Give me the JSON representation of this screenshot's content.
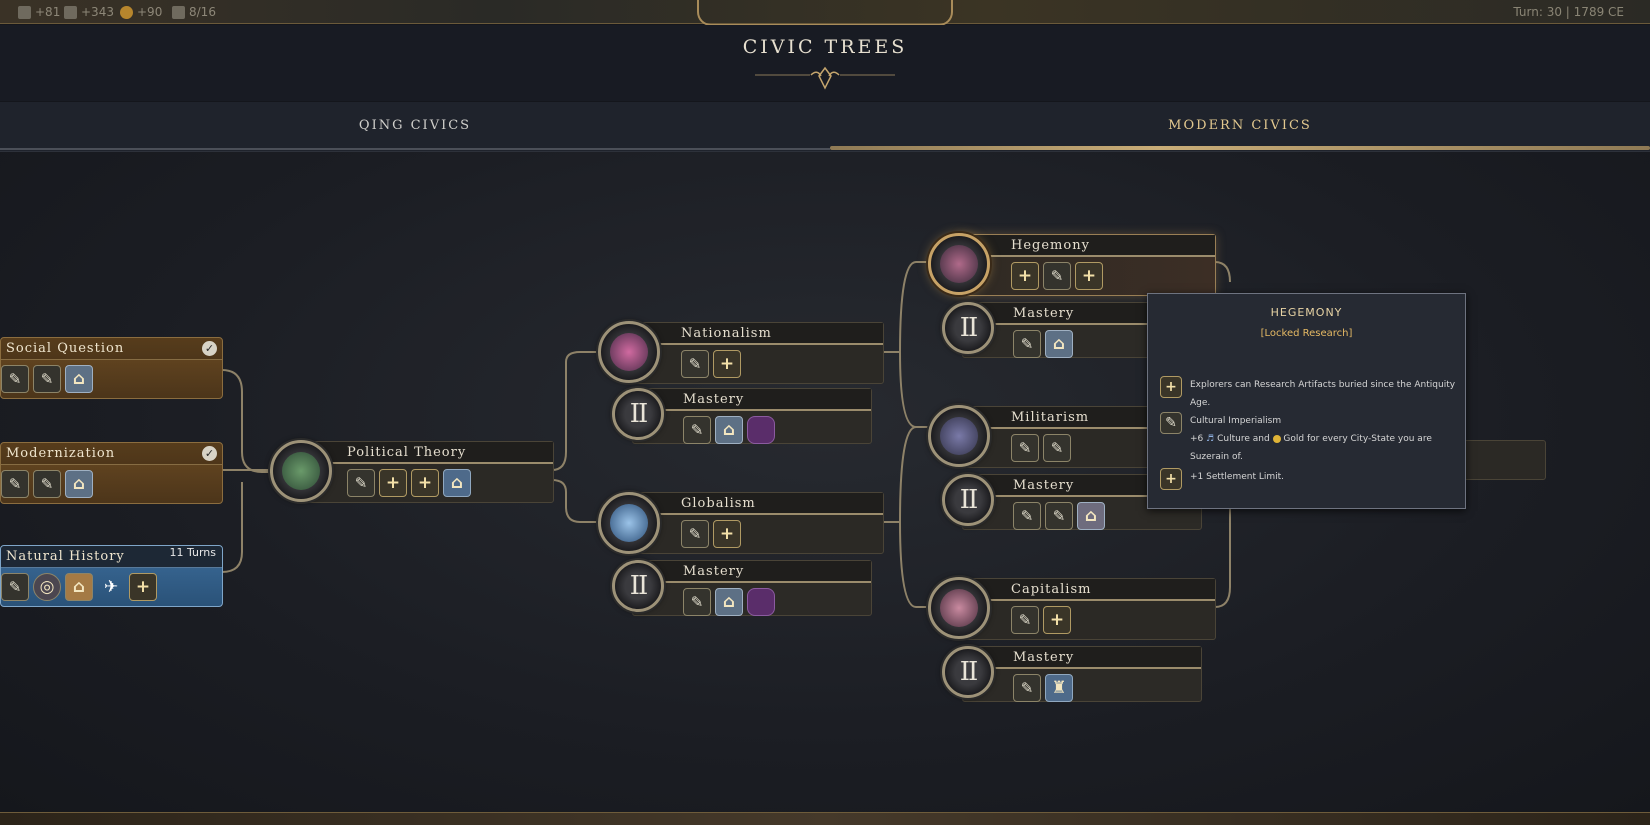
{
  "topbar": {
    "resources": [
      {
        "icon": "science-icon",
        "value": "+81"
      },
      {
        "icon": "culture-icon",
        "value": "+343"
      },
      {
        "icon": "gold-icon",
        "value": "+90"
      },
      {
        "icon": "settlement-icon",
        "value": "8/16"
      }
    ],
    "turn": "Turn: 30",
    "sep": "|",
    "year": "1789 CE"
  },
  "header": {
    "title": "CIVIC TREES"
  },
  "tabs": [
    {
      "label": "QING CIVICS",
      "active": false
    },
    {
      "label": "MODERN CIVICS",
      "active": true
    }
  ],
  "left_cards": [
    {
      "title": "Social Question",
      "state": "completed",
      "icons": [
        "pen-icon",
        "pen-icon",
        "building-icon"
      ]
    },
    {
      "title": "Modernization",
      "state": "completed",
      "icons": [
        "pen-icon",
        "pen-icon",
        "building-icon"
      ]
    },
    {
      "title": "Natural History",
      "state": "researching",
      "turns": "11 Turns",
      "icons": [
        "pen-icon",
        "wonder-icon",
        "building-icon",
        "dove-icon",
        "plus-icon"
      ]
    }
  ],
  "nodes": {
    "political_theory": {
      "title": "Political Theory",
      "icons": [
        "pen-icon",
        "plus-icon",
        "plus-icon",
        "building-icon"
      ]
    },
    "nationalism": {
      "title": "Nationalism",
      "icons": [
        "pen-icon",
        "plus-icon"
      ]
    },
    "nationalism_mastery": {
      "title": "Mastery",
      "roman": "II",
      "icons": [
        "pen-icon",
        "building-icon",
        "purple-icon"
      ]
    },
    "globalism": {
      "title": "Globalism",
      "icons": [
        "pen-icon",
        "plus-icon"
      ]
    },
    "globalism_mastery": {
      "title": "Mastery",
      "roman": "II",
      "icons": [
        "pen-icon",
        "building-icon",
        "purple-icon"
      ]
    },
    "hegemony": {
      "title": "Hegemony",
      "icons": [
        "plus-icon",
        "pen-icon",
        "plus-icon"
      ]
    },
    "hegemony_mastery": {
      "title": "Mastery",
      "roman": "II",
      "icons": [
        "pen-icon",
        "building-icon"
      ]
    },
    "militarism": {
      "title": "Militarism",
      "icons": [
        "pen-icon",
        "pen-icon"
      ]
    },
    "militarism_mastery": {
      "title": "Mastery",
      "roman": "II",
      "icons": [
        "pen-icon",
        "pen-icon",
        "building-icon"
      ]
    },
    "capitalism": {
      "title": "Capitalism",
      "icons": [
        "pen-icon",
        "plus-icon"
      ]
    },
    "capitalism_mastery": {
      "title": "Mastery",
      "roman": "II",
      "icons": [
        "pen-icon",
        "statue-icon"
      ]
    }
  },
  "tooltip": {
    "title": "HEGEMONY",
    "subtitle": "[Locked Research]",
    "rows": [
      {
        "icon": "plus-icon",
        "text": "Explorers can Research Artifacts buried since the Antiquity Age."
      },
      {
        "icon": "pen-icon",
        "text_a": "Cultural Imperialism",
        "text_b": "+6",
        "text_c": "Culture and",
        "text_d": "Gold for every City-State you are Suzerain of."
      },
      {
        "icon": "plus-icon",
        "text": "+1 Settlement Limit."
      }
    ]
  },
  "colors": {
    "accent_gold": "#c9ad78",
    "completed": "#6a4a22",
    "researching": "#3c6c9a",
    "tooltip_title": "#e7d3a4"
  }
}
